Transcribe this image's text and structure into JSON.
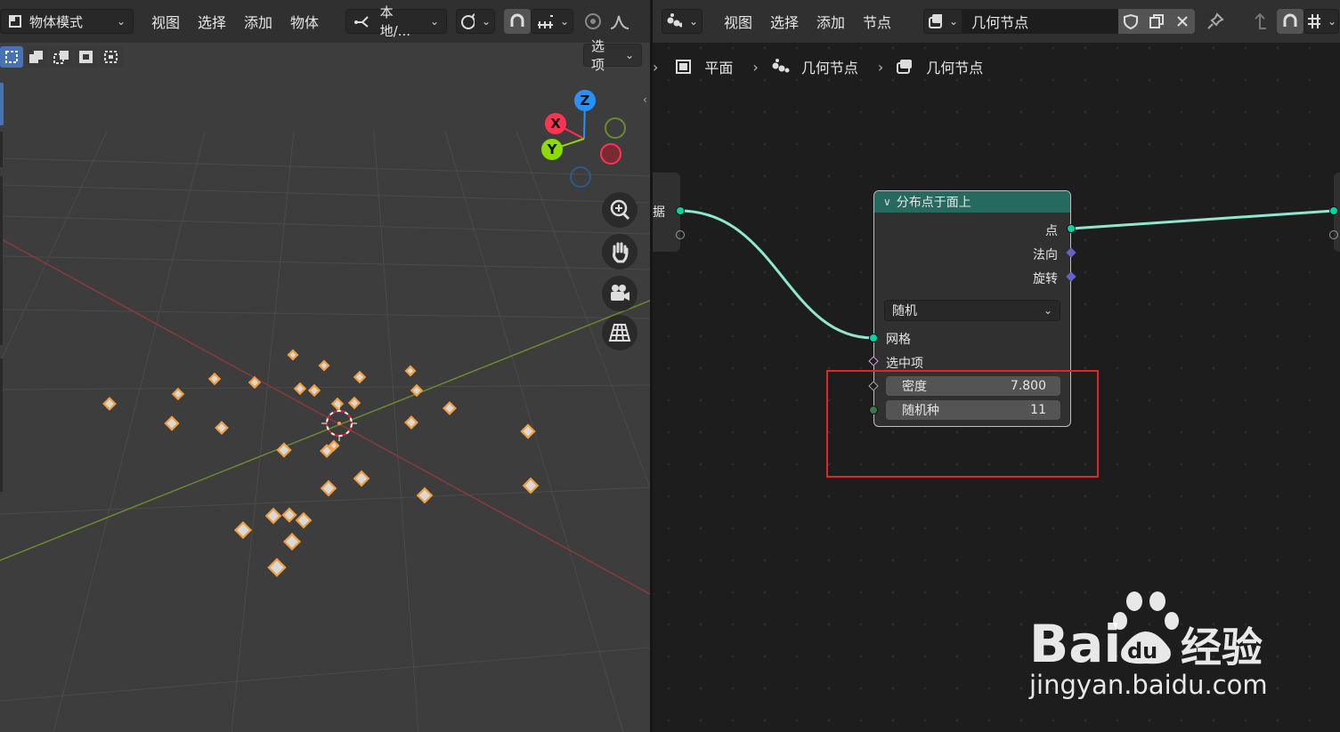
{
  "left_header": {
    "mode_label": "物体模式",
    "menus": [
      "视图",
      "选择",
      "添加",
      "物体"
    ],
    "transform_label": "本地/...",
    "options_label": "选项"
  },
  "gizmo": {
    "z_label": "Z",
    "x_label": "X",
    "y_label": "Y"
  },
  "right_header": {
    "menus": [
      "视图",
      "选择",
      "添加",
      "节点"
    ],
    "node_tree_name": "几何节点"
  },
  "breadcrumb": {
    "items": [
      "平面",
      "几何节点",
      "几何节点"
    ]
  },
  "input_node_fragment": {
    "label": "据"
  },
  "node": {
    "title": "分布点于面上",
    "outputs": [
      "点",
      "法向",
      "旋转"
    ],
    "mode_select": "随机",
    "inputs": [
      "网格",
      "选中项"
    ],
    "density_label": "密度",
    "density_value": "7.800",
    "seed_label": "随机种",
    "seed_value": "11"
  },
  "colors": {
    "node_header": "#266a5f",
    "geometry_socket": "#00d6a3",
    "vector_socket": "#6363c7",
    "highlight_box": "#e0242b",
    "selected_object": "#f0a040",
    "axis_x": "#ff3352",
    "axis_y": "#8bdc00",
    "axis_z": "#2890ff"
  },
  "watermark": {
    "logo": "Bai du 经验",
    "url": "jingyan.baidu.com"
  }
}
